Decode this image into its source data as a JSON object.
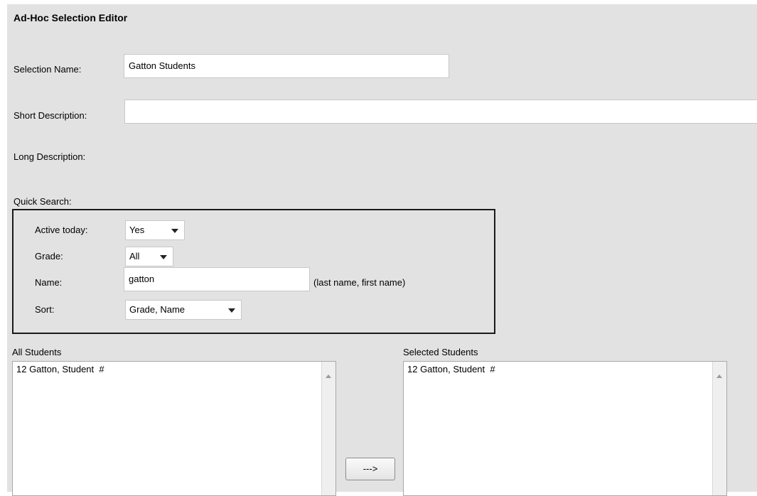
{
  "editor": {
    "title": "Ad-Hoc Selection Editor"
  },
  "form": {
    "selection_name_label": "Selection Name:",
    "selection_name_value": "Gatton Students",
    "short_description_label": "Short Description:",
    "short_description_value": "",
    "long_description_label": "Long Description:"
  },
  "quick_search": {
    "label": "Quick Search:",
    "active_today_label": "Active today:",
    "active_today_value": "Yes",
    "grade_label": "Grade:",
    "grade_value": "All",
    "name_label": "Name:",
    "name_value": "gatton",
    "name_hint": "(last name, first name)",
    "sort_label": "Sort:",
    "sort_value": "Grade, Name"
  },
  "all_students": {
    "label": "All Students",
    "items": [
      "12 Gatton, Student  #"
    ]
  },
  "selected_students": {
    "label": "Selected Students",
    "items": [
      "12 Gatton, Student  #"
    ]
  },
  "actions": {
    "move_right_label": "--->"
  },
  "icons": {
    "dropdown": "chevron-down-icon",
    "scroll_up": "scroll-up-arrow-icon"
  }
}
